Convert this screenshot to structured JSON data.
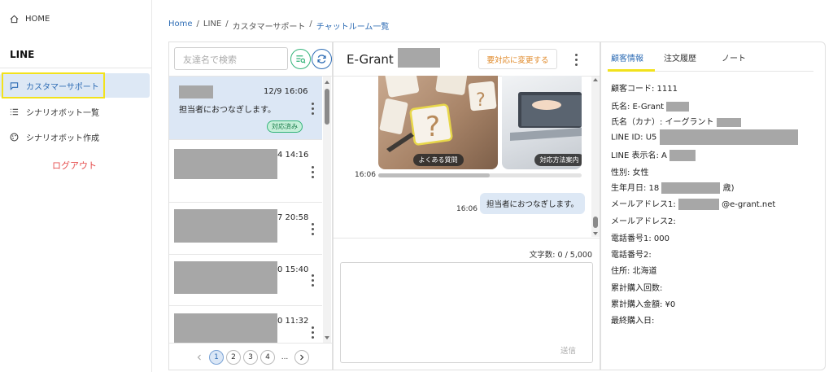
{
  "sidebar": {
    "home_label": "HOME",
    "section_title": "LINE",
    "items": [
      {
        "label": "カスタマーサポート"
      },
      {
        "label": "シナリオボット一覧"
      },
      {
        "label": "シナリオボット作成"
      }
    ],
    "logout_label": "ログアウト"
  },
  "breadcrumb": [
    "Home",
    "LINE",
    "カスタマーサポート",
    "チャットルーム一覧"
  ],
  "list": {
    "search_placeholder": "友達名で検索",
    "conversations": [
      {
        "time": "12/9 16:06",
        "message": "担当者におつなぎします。",
        "badge": "対応済み"
      },
      {
        "time": "4 14:16"
      },
      {
        "time": "7 20:58"
      },
      {
        "time": "0 15:40"
      },
      {
        "time": "0 11:32"
      }
    ],
    "pages": [
      "1",
      "2",
      "3",
      "4",
      "..."
    ]
  },
  "chat": {
    "title": "E-Grant",
    "status_button": "要対応に変更する",
    "cards": [
      "よくある質問",
      "対応方法案内"
    ],
    "card_time": "16:06",
    "bubble_time": "16:06",
    "bubble_text": "担当者におつなぎします。",
    "char_count": "文字数: 0 / 5,000",
    "send_label": "送信"
  },
  "info": {
    "tabs": [
      "顧客情報",
      "注文履歴",
      "ノート"
    ],
    "rows": [
      "顧客コード: 1111",
      "氏名: E-Grant",
      "氏名（カナ）: イーグラント",
      "LINE ID: U5",
      "LINE 表示名: A",
      "性別: 女性",
      "生年月日: 18",
      "メールアドレス1:",
      "メールアドレス2:",
      "電話番号1: 000",
      "電話番号2:",
      "住所: 北海道",
      "累計購入回数:",
      "累計購入金額: ¥0",
      "最終購入日:"
    ],
    "birth_suffix": "歳)",
    "email_domain": "@e-grant.net"
  },
  "colors": {
    "accent": "#2f6db5",
    "highlight": "#f2e21c",
    "logout": "#e54d4d",
    "warn": "#e08a2a"
  }
}
